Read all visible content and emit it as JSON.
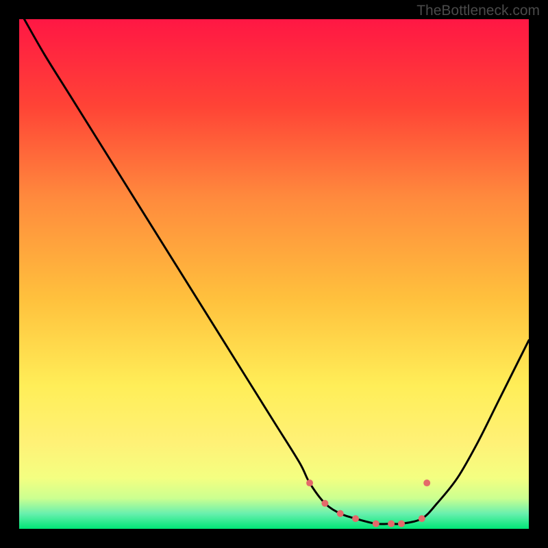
{
  "watermark": "TheBottleneck.com",
  "chart_data": {
    "type": "line",
    "title": "",
    "xlabel": "",
    "ylabel": "",
    "xlim": [
      0,
      100
    ],
    "ylim": [
      0,
      100
    ],
    "gradient_stops": [
      {
        "offset": 0,
        "color": "#ff1744"
      },
      {
        "offset": 17,
        "color": "#ff4336"
      },
      {
        "offset": 35,
        "color": "#ff8a3d"
      },
      {
        "offset": 55,
        "color": "#ffc13d"
      },
      {
        "offset": 72,
        "color": "#ffee58"
      },
      {
        "offset": 83,
        "color": "#fff176"
      },
      {
        "offset": 90,
        "color": "#f4ff81"
      },
      {
        "offset": 94,
        "color": "#ccff90"
      },
      {
        "offset": 97,
        "color": "#69f0ae"
      },
      {
        "offset": 100,
        "color": "#00e676"
      }
    ],
    "series": [
      {
        "name": "bottleneck-curve",
        "color": "#000000",
        "x": [
          1,
          5,
          10,
          15,
          20,
          25,
          30,
          35,
          40,
          45,
          50,
          55,
          57,
          60,
          63,
          66,
          70,
          73,
          75,
          79,
          82,
          86,
          90,
          94,
          98,
          100
        ],
        "y": [
          100,
          93,
          85,
          77,
          69,
          61,
          53,
          45,
          37,
          29,
          21,
          13,
          9,
          5,
          3,
          2,
          1,
          1,
          1,
          2,
          5,
          10,
          17,
          25,
          33,
          37
        ]
      }
    ],
    "markers": [
      {
        "x": 57,
        "y": 9,
        "color": "#e46a6a",
        "r": 5
      },
      {
        "x": 60,
        "y": 5,
        "color": "#e46a6a",
        "r": 5
      },
      {
        "x": 63,
        "y": 3,
        "color": "#e46a6a",
        "r": 5
      },
      {
        "x": 66,
        "y": 2,
        "color": "#e46a6a",
        "r": 5
      },
      {
        "x": 70,
        "y": 1,
        "color": "#e46a6a",
        "r": 5
      },
      {
        "x": 73,
        "y": 1,
        "color": "#e46a6a",
        "r": 5
      },
      {
        "x": 75,
        "y": 1,
        "color": "#e46a6a",
        "r": 5
      },
      {
        "x": 79,
        "y": 2,
        "color": "#e46a6a",
        "r": 5
      },
      {
        "x": 80,
        "y": 9,
        "color": "#e46a6a",
        "r": 5
      }
    ]
  }
}
